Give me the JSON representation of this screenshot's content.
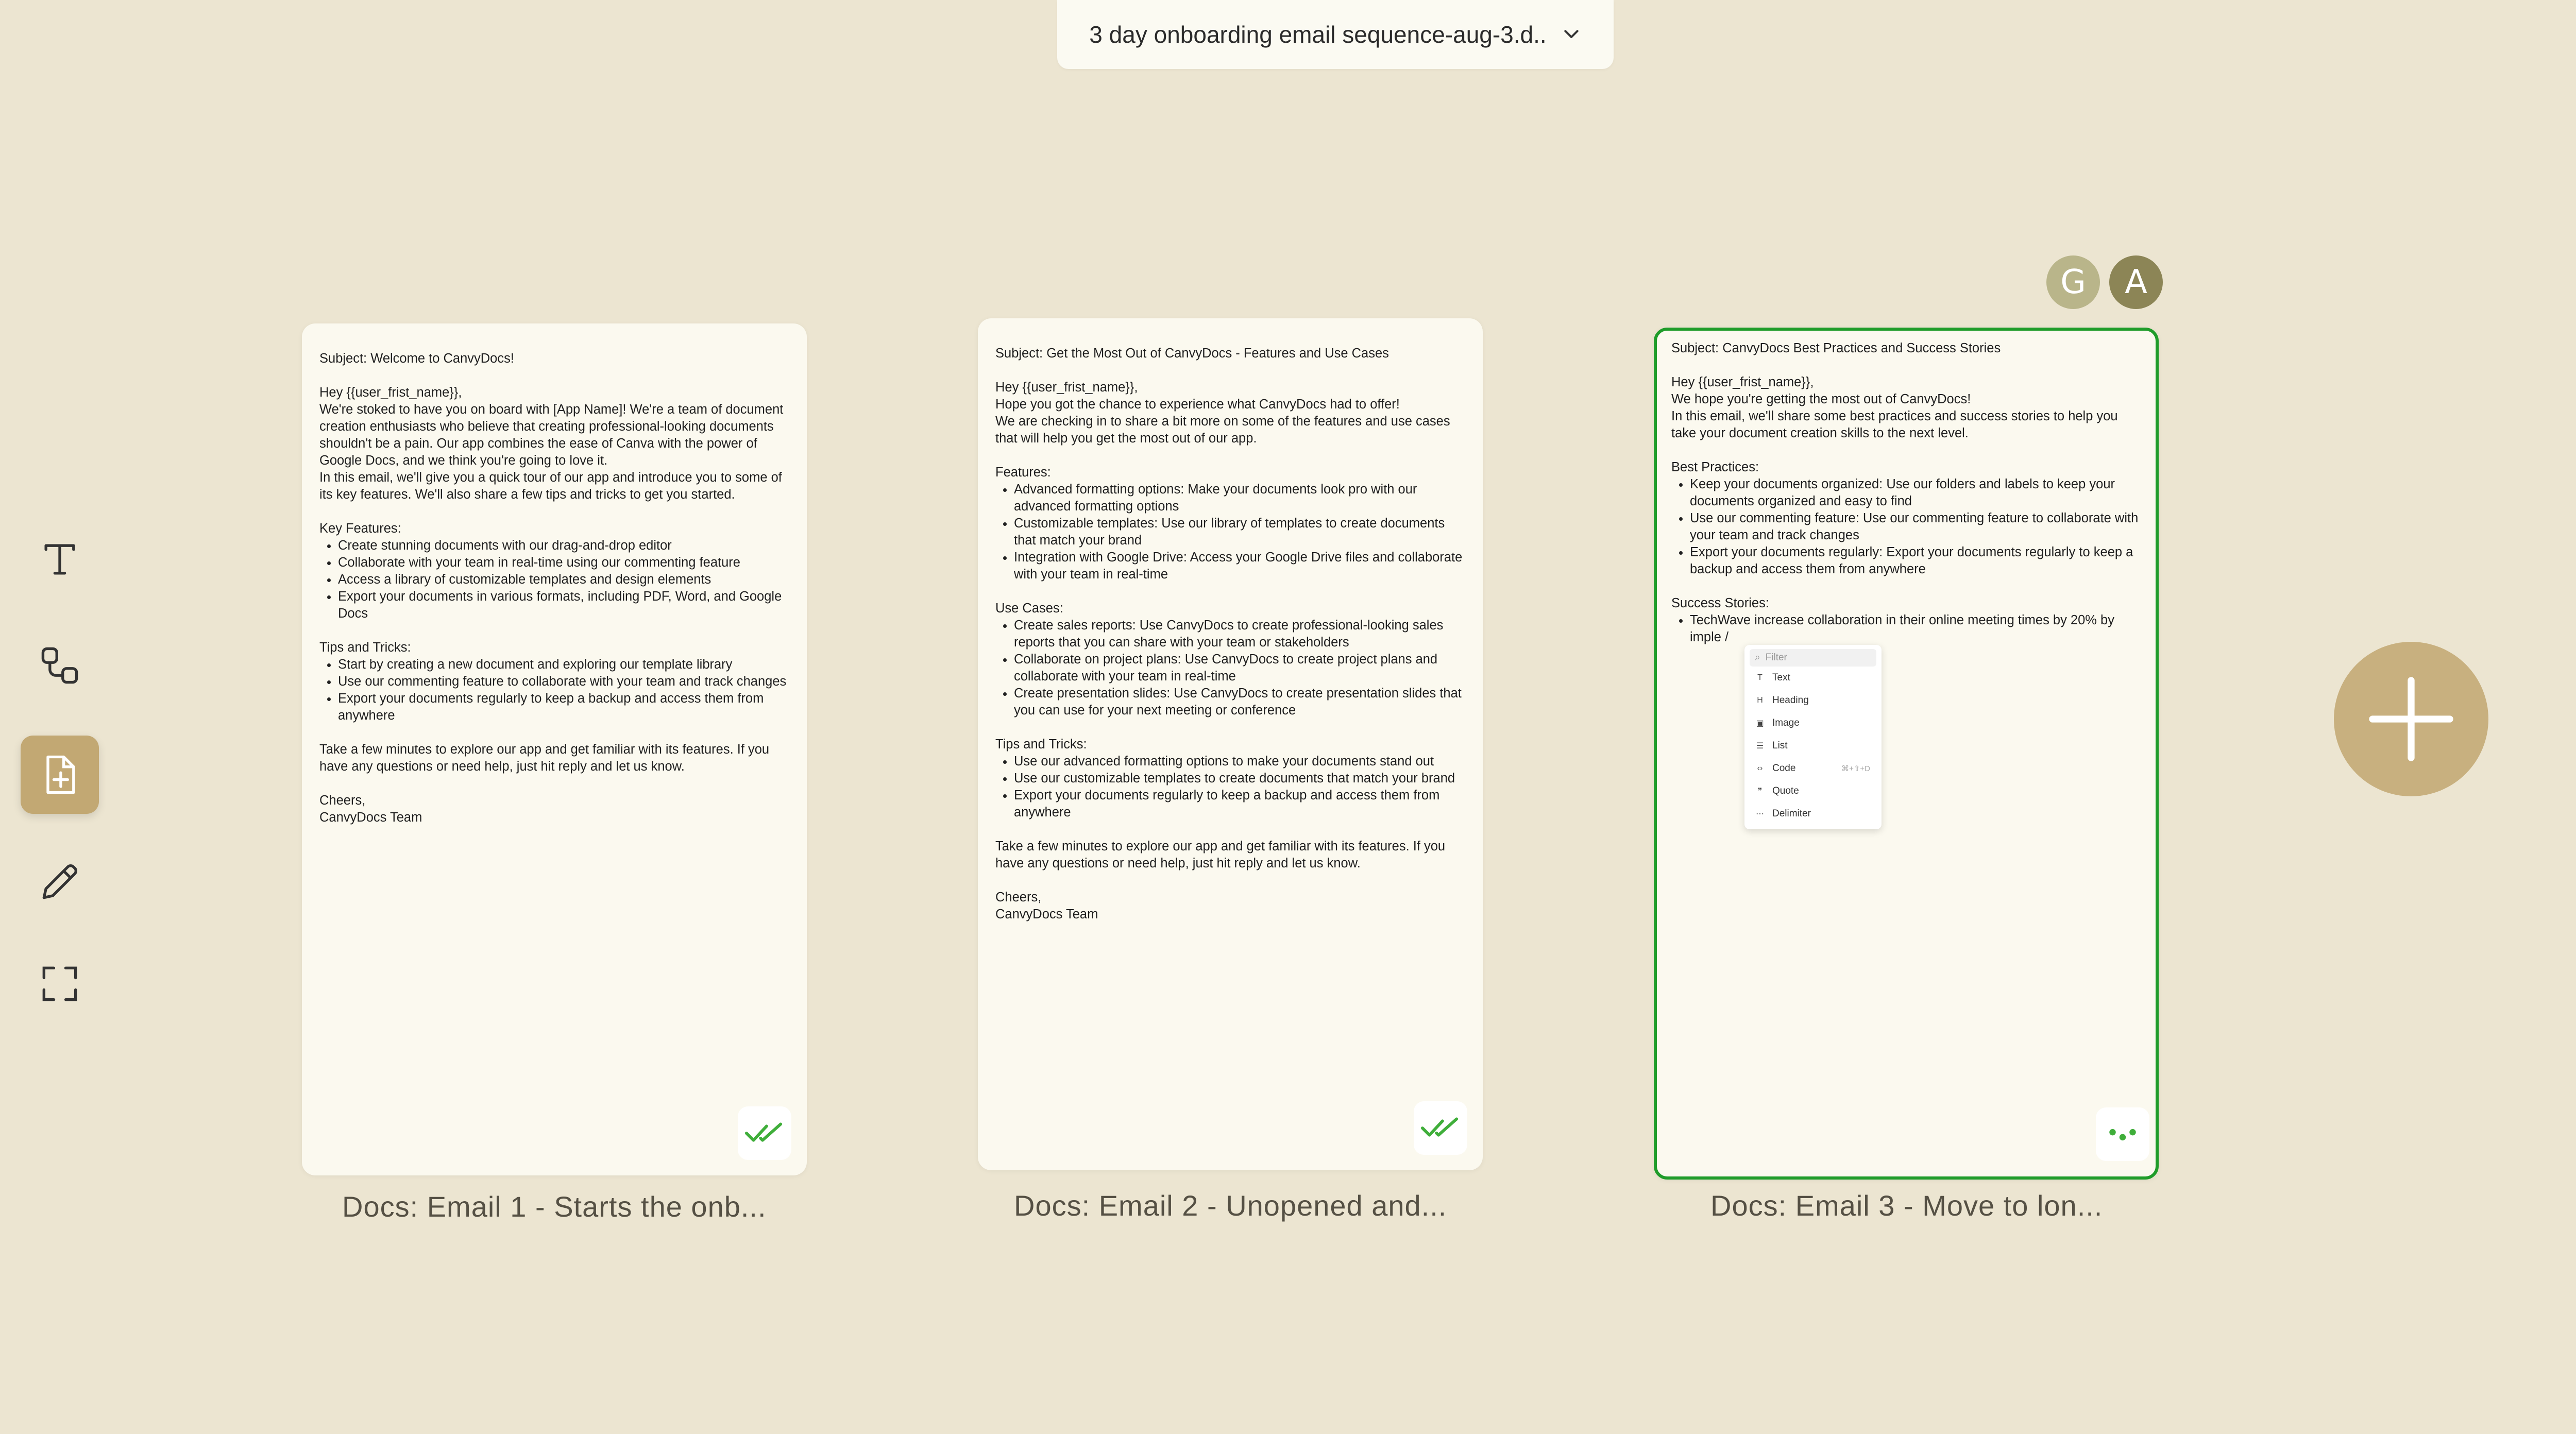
{
  "header": {
    "title": "3 day onboarding email sequence-aug-3.d.."
  },
  "avatars": [
    {
      "initial": "G"
    },
    {
      "initial": "A"
    }
  ],
  "toolbar": [
    {
      "name": "text-tool",
      "icon": "text-icon"
    },
    {
      "name": "connector-tool",
      "icon": "connector-icon"
    },
    {
      "name": "add-doc-tool",
      "icon": "add-document-icon",
      "active": true
    },
    {
      "name": "pen-tool",
      "icon": "pencil-icon"
    },
    {
      "name": "frame-tool",
      "icon": "frame-icon"
    }
  ],
  "cards": [
    {
      "caption": "Docs: Email 1 - Starts the onb...",
      "status": "done",
      "subject": "Subject: Welcome to CanvyDocs!",
      "greeting": "Hey {{user_frist_name}},",
      "intro": [
        "We're stoked to have you on board with [App Name]! We're a team of document creation enthusiasts who believe that creating professional-looking documents shouldn't be a pain. Our app combines the ease of Canva with the power of Google Docs, and we think you're going to love it.",
        "In this email, we'll give you a quick tour of our app and introduce you to some of its key features. We'll also share a few tips and tricks to get you started."
      ],
      "section1_title": "Key Features:",
      "section1_items": [
        "Create stunning documents with our drag-and-drop editor",
        "Collaborate with your team in real-time using our commenting feature",
        "Access a library of customizable templates and design elements",
        "Export your documents in various formats, including PDF, Word, and Google Docs"
      ],
      "section2_title": "Tips and Tricks:",
      "section2_items": [
        "Start by creating a new document and exploring our template library",
        "Use our commenting feature to collaborate with your team and track changes",
        "Export your documents regularly to keep a backup and access them from anywhere"
      ],
      "closing": "Take a few minutes to explore our app and get familiar with its features. If you have any questions or need help, just hit reply and let us know.",
      "signoff": "Cheers,",
      "signature": "CanvyDocs Team"
    },
    {
      "caption": "Docs: Email 2 - Unopened and...",
      "status": "done",
      "subject": "Subject: Get the Most Out of CanvyDocs - Features and Use Cases",
      "greeting": "Hey {{user_frist_name}},",
      "intro": [
        "Hope you got the chance to experience what CanvyDocs had to offer!",
        "We are checking in to share a bit more on some of the features and use cases that will help you get the most out of our app."
      ],
      "section1_title": "Features:",
      "section1_items": [
        "Advanced formatting options: Make your documents look pro with our advanced formatting options",
        "Customizable templates: Use our library of templates to create documents that match your brand",
        "Integration with Google Drive: Access your Google Drive files and collaborate with your team in real-time"
      ],
      "section2_title": "Use Cases:",
      "section2_items": [
        "Create sales reports: Use CanvyDocs to create professional-looking sales reports that you can share with your team or stakeholders",
        "Collaborate on project plans: Use CanvyDocs to create project plans and collaborate with your team in real-time",
        "Create presentation slides: Use CanvyDocs to create presentation slides that you can use for your next meeting or conference"
      ],
      "section3_title": "Tips and Tricks:",
      "section3_items": [
        "Use our advanced formatting options to make your documents stand out",
        "Use our customizable templates to create documents that match your brand",
        "Export your documents regularly to keep a backup and access them from anywhere"
      ],
      "closing": "Take a few minutes to explore our app and get familiar with its features. If you have any questions or need help, just hit reply and let us know.",
      "signoff": "Cheers,",
      "signature": "CanvyDocs Team"
    },
    {
      "caption": "Docs: Email 3 - Move to lon...",
      "status": "in-progress",
      "subject": "Subject: CanvyDocs Best Practices and Success Stories",
      "greeting": "Hey {{user_frist_name}},",
      "intro": [
        "We hope you're  getting the most out of CanvyDocs!",
        "In this email, we'll share some best practices and success stories to help you take your document creation skills to the next level."
      ],
      "section1_title": "Best Practices:",
      "section1_items": [
        "Keep your documents organized: Use our folders and labels to keep your documents organized and easy to find",
        "Use our commenting feature: Use our commenting feature to collaborate with your team and track changes",
        "Export your documents regularly: Export your documents regularly to keep a backup and access them from anywhere"
      ],
      "section2_title": "Success Stories:",
      "section2_items": [
        "TechWave increase collaboration in their online meeting times by 20% by imple /"
      ]
    }
  ],
  "slash_menu": {
    "filter_placeholder": "Filter",
    "items": [
      {
        "icon": "T",
        "label": "Text",
        "shortcut": ""
      },
      {
        "icon": "H",
        "label": "Heading",
        "shortcut": ""
      },
      {
        "icon": "▣",
        "label": "Image",
        "shortcut": ""
      },
      {
        "icon": "☰",
        "label": "List",
        "shortcut": ""
      },
      {
        "icon": "‹›",
        "label": "Code",
        "shortcut": "⌘+⇧+D"
      },
      {
        "icon": "❞",
        "label": "Quote",
        "shortcut": ""
      },
      {
        "icon": "⋯",
        "label": "Delimiter",
        "shortcut": ""
      }
    ]
  },
  "colors": {
    "background": "#ece5d1",
    "card": "#fbf9ef",
    "accent_green": "#1f9c2a",
    "tool_active": "#c2a873",
    "plus_button": "#c8b07f"
  }
}
